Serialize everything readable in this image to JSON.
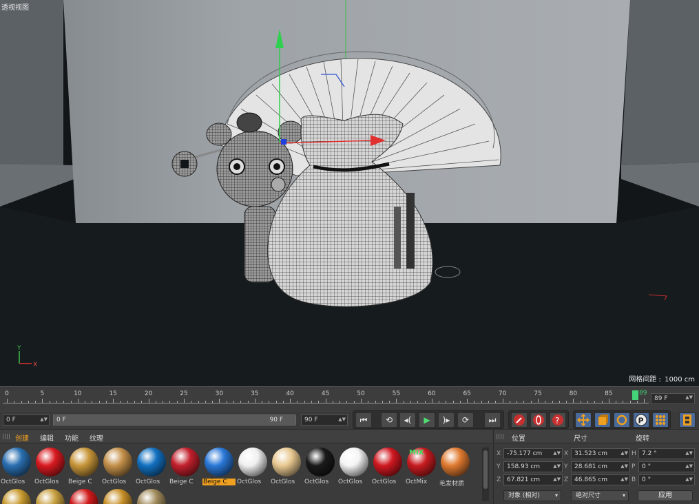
{
  "viewport": {
    "title": "透视视图",
    "grid_label": "网格间距 :",
    "grid_value": "1000 cm",
    "axis_y": "Y",
    "axis_x": "X"
  },
  "timeline": {
    "ticks": [
      "0",
      "5",
      "10",
      "15",
      "20",
      "25",
      "30",
      "35",
      "40",
      "45",
      "50",
      "55",
      "60",
      "65",
      "70",
      "75",
      "80",
      "85"
    ],
    "current_frame_marker": "89",
    "current_frame_field": "89 F",
    "range_start": "0 F",
    "range_min": "0 F",
    "range_max": "90 F",
    "range_end": "90 F"
  },
  "transport": {
    "go_start": "⏮",
    "prev_key": "⟲",
    "prev_frame": "◂(",
    "play": "▶",
    "next_frame": ")▸",
    "next_key": "⟳",
    "go_end": "⏭"
  },
  "materials": {
    "menu": [
      "创建",
      "编辑",
      "功能",
      "纹理"
    ],
    "row1": [
      {
        "label": "OctGlos",
        "color": "#2a6fb0"
      },
      {
        "label": "OctGlos",
        "color": "#d81a20"
      },
      {
        "label": "Beige C",
        "color": "#c8963a"
      },
      {
        "label": "OctGlos",
        "color": "#c4904a"
      },
      {
        "label": "OctGlos",
        "color": "#1270c0"
      },
      {
        "label": "Beige C",
        "color": "#c2202c"
      },
      {
        "label": "Beige C",
        "color": "#2a78d8",
        "selected": true
      },
      {
        "label": "OctGlos",
        "color": "#f0f0f0"
      },
      {
        "label": "OctGlos",
        "color": "#e8c890"
      },
      {
        "label": "OctGlos",
        "color": "#1a1a1a"
      },
      {
        "label": "OctGlos",
        "color": "#f4f4f4"
      },
      {
        "label": "OctGlos",
        "color": "#d01820"
      },
      {
        "label": "OctMix",
        "color": "#c81c20",
        "mix_text": "MIX"
      },
      {
        "label": "毛发材质",
        "color": "#e07a30"
      }
    ],
    "row2_colors": [
      "#c89a30",
      "#c8a040",
      "#d01a1a",
      "#c89028",
      "#a08a5a"
    ]
  },
  "coordinates": {
    "headers": [
      "位置",
      "尺寸",
      "旋转"
    ],
    "rows": [
      {
        "axis1": "X",
        "pos": "-75.177 cm",
        "axis2": "X",
        "size": "31.523 cm",
        "axis3": "H",
        "rot": "7.2 °"
      },
      {
        "axis1": "Y",
        "pos": "158.93 cm",
        "axis2": "Y",
        "size": "28.681 cm",
        "axis3": "P",
        "rot": "0 °"
      },
      {
        "axis1": "Z",
        "pos": "67.821 cm",
        "axis2": "Z",
        "size": "46.865 cm",
        "axis3": "B",
        "rot": "0 °"
      }
    ],
    "mode_dropdown": "对象 (相对)",
    "size_dropdown": "绝对尺寸",
    "apply": "应用"
  }
}
